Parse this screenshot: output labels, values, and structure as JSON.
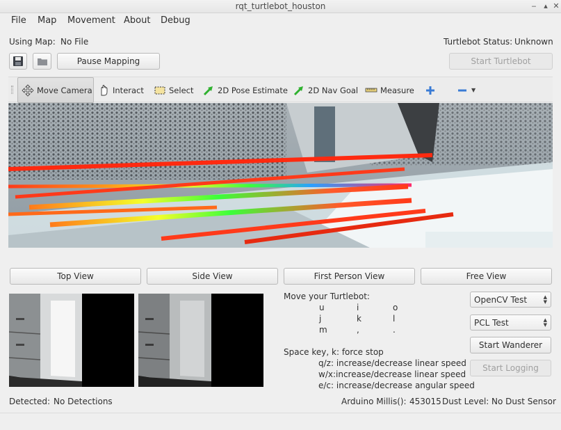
{
  "window": {
    "title": "rqt_turtlebot_houston"
  },
  "menu": [
    "File",
    "Map",
    "Movement",
    "About",
    "Debug"
  ],
  "status": {
    "using_map_label": "Using Map:",
    "using_map_value": "No File",
    "turtlebot_status_label": "Turtlebot Status:",
    "turtlebot_status_value": "Unknown"
  },
  "buttons": {
    "pause_mapping": "Pause Mapping",
    "start_turtlebot": "Start Turtlebot"
  },
  "tools": [
    {
      "label": "Move Camera",
      "icon": "move-camera-icon"
    },
    {
      "label": "Interact",
      "icon": "hand-icon"
    },
    {
      "label": "Select",
      "icon": "select-box-icon"
    },
    {
      "label": "2D Pose Estimate",
      "icon": "green-arrow-icon"
    },
    {
      "label": "2D Nav Goal",
      "icon": "green-arrow-icon"
    },
    {
      "label": "Measure",
      "icon": "ruler-icon"
    }
  ],
  "views": [
    "Top View",
    "Side View",
    "First Person View",
    "Free View"
  ],
  "teleop": {
    "heading": "Move your Turtlebot:",
    "row1": [
      "u",
      "i",
      "o"
    ],
    "row2": [
      "j",
      "k",
      "l"
    ],
    "row3": [
      "m",
      ",",
      "."
    ],
    "space": "Space key, k: force stop",
    "qz": "q/z: increase/decrease linear speed",
    "wx": "w/x:increase/decrease linear speed",
    "ec": "e/c: increase/decrease angular speed"
  },
  "controls": {
    "combo1": "OpenCV Test",
    "combo2": "PCL Test",
    "start_wanderer": "Start Wanderer",
    "start_logging": "Start Logging"
  },
  "footer": {
    "detected_label": "Detected:",
    "detected_value": "No Detections",
    "millis_label": "Arduino Millis():",
    "millis_value": "453015",
    "dust_label": "Dust Level:",
    "dust_value": "No Dust Sensor"
  },
  "colors": {
    "accent_green": "#2fb12f",
    "add_blue": "#3a7bd5"
  }
}
